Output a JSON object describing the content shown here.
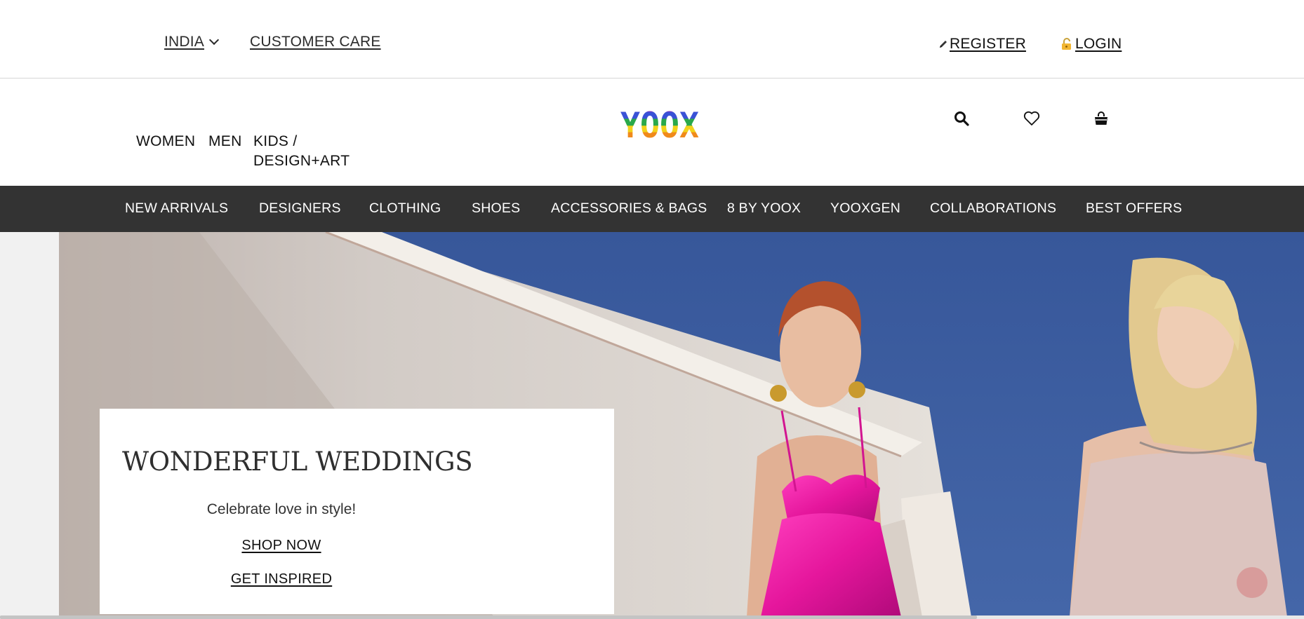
{
  "utility": {
    "country": "INDIA",
    "customer_care": "CUSTOMER CARE",
    "register": "REGISTER",
    "login": "LOGIN"
  },
  "header": {
    "genders": [
      "WOMEN",
      "MEN",
      "KIDS / DESIGN+ART"
    ],
    "logo": "YOOX",
    "icons": [
      "search-icon",
      "heart-icon",
      "shopping-bag-icon"
    ]
  },
  "nav": {
    "items": [
      "NEW ARRIVALS",
      "DESIGNERS",
      "CLOTHING",
      "SHOES",
      "ACCESSORIES & BAGS",
      "8 BY YOOX",
      "YOOXGEN",
      "COLLABORATIONS",
      "BEST OFFERS"
    ]
  },
  "hero": {
    "title": "WONDERFUL WEDDINGS",
    "subtitle": "Celebrate love in style!",
    "shop_now": "SHOP NOW",
    "get_inspired": "GET INSPIRED"
  },
  "colors": {
    "nav_bg": "#333333",
    "sky": "#3f5f9e",
    "dress": "#e5169c"
  }
}
